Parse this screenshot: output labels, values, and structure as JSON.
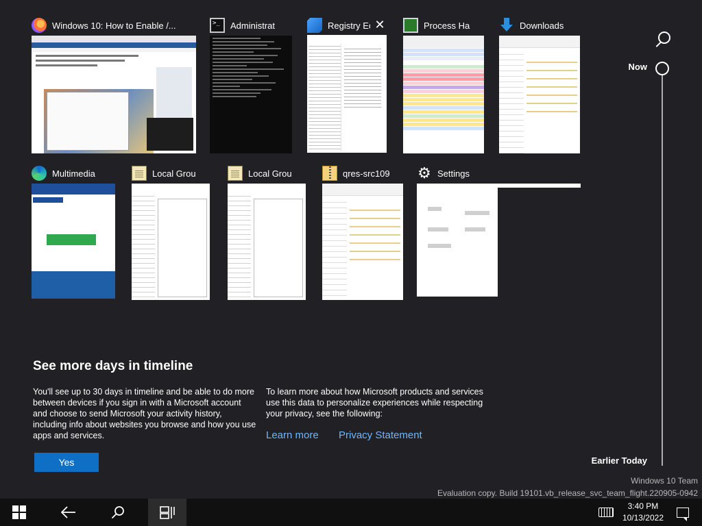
{
  "timeline": {
    "now_label": "Now",
    "earlier_label": "Earlier Today",
    "search_icon": "search-icon"
  },
  "windows": [
    {
      "title": "Windows 10: How to Enable /...",
      "icon": "firefox-icon"
    },
    {
      "title": "Administrat",
      "icon": "command-prompt-icon"
    },
    {
      "title": "Registry Edi",
      "icon": "registry-editor-icon",
      "selected": true,
      "close": "✕"
    },
    {
      "title": "Process Ha",
      "icon": "process-hacker-icon"
    },
    {
      "title": "Downloads",
      "icon": "download-folder-icon"
    },
    {
      "title": "Multimedia",
      "icon": "edge-icon"
    },
    {
      "title": "Local Grou",
      "icon": "notepad-icon"
    },
    {
      "title": "Local Grou",
      "icon": "notepad-icon"
    },
    {
      "title": "qres-src109",
      "icon": "zip-folder-icon"
    },
    {
      "title": "Settings",
      "icon": "gear-icon"
    }
  ],
  "info": {
    "title": "See more days in timeline",
    "body": "You'll see up to 30 days in timeline and be able to do more between devices if you sign in with a Microsoft account and choose to send Microsoft your activity history, including info about websites you browse and how you use apps and services.",
    "right": "To learn more about how Microsoft products and services use this data to personalize experiences while respecting your privacy, see the following:",
    "learn_more": "Learn more",
    "privacy": "Privacy Statement",
    "yes": "Yes"
  },
  "watermark": {
    "line1": "Windows 10 Team",
    "line2": "Evaluation copy. Build 19101.vb_release_svc_team_flight.220905-0942"
  },
  "taskbar": {
    "time": "3:40 PM",
    "date": "10/13/2022"
  },
  "colors": {
    "background": "#202025",
    "accent": "#0e6fc4",
    "link": "#6fb8ff"
  }
}
